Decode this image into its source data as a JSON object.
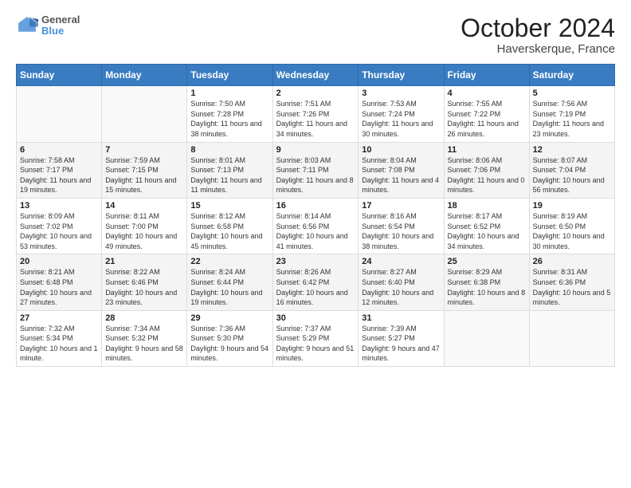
{
  "header": {
    "logo_line1": "General",
    "logo_line2": "Blue",
    "title": "October 2024",
    "subtitle": "Haverskerque, France"
  },
  "weekdays": [
    "Sunday",
    "Monday",
    "Tuesday",
    "Wednesday",
    "Thursday",
    "Friday",
    "Saturday"
  ],
  "weeks": [
    [
      {
        "day": "",
        "info": ""
      },
      {
        "day": "",
        "info": ""
      },
      {
        "day": "1",
        "info": "Sunrise: 7:50 AM\nSunset: 7:28 PM\nDaylight: 11 hours and 38 minutes."
      },
      {
        "day": "2",
        "info": "Sunrise: 7:51 AM\nSunset: 7:26 PM\nDaylight: 11 hours and 34 minutes."
      },
      {
        "day": "3",
        "info": "Sunrise: 7:53 AM\nSunset: 7:24 PM\nDaylight: 11 hours and 30 minutes."
      },
      {
        "day": "4",
        "info": "Sunrise: 7:55 AM\nSunset: 7:22 PM\nDaylight: 11 hours and 26 minutes."
      },
      {
        "day": "5",
        "info": "Sunrise: 7:56 AM\nSunset: 7:19 PM\nDaylight: 11 hours and 23 minutes."
      }
    ],
    [
      {
        "day": "6",
        "info": "Sunrise: 7:58 AM\nSunset: 7:17 PM\nDaylight: 11 hours and 19 minutes."
      },
      {
        "day": "7",
        "info": "Sunrise: 7:59 AM\nSunset: 7:15 PM\nDaylight: 11 hours and 15 minutes."
      },
      {
        "day": "8",
        "info": "Sunrise: 8:01 AM\nSunset: 7:13 PM\nDaylight: 11 hours and 11 minutes."
      },
      {
        "day": "9",
        "info": "Sunrise: 8:03 AM\nSunset: 7:11 PM\nDaylight: 11 hours and 8 minutes."
      },
      {
        "day": "10",
        "info": "Sunrise: 8:04 AM\nSunset: 7:08 PM\nDaylight: 11 hours and 4 minutes."
      },
      {
        "day": "11",
        "info": "Sunrise: 8:06 AM\nSunset: 7:06 PM\nDaylight: 11 hours and 0 minutes."
      },
      {
        "day": "12",
        "info": "Sunrise: 8:07 AM\nSunset: 7:04 PM\nDaylight: 10 hours and 56 minutes."
      }
    ],
    [
      {
        "day": "13",
        "info": "Sunrise: 8:09 AM\nSunset: 7:02 PM\nDaylight: 10 hours and 53 minutes."
      },
      {
        "day": "14",
        "info": "Sunrise: 8:11 AM\nSunset: 7:00 PM\nDaylight: 10 hours and 49 minutes."
      },
      {
        "day": "15",
        "info": "Sunrise: 8:12 AM\nSunset: 6:58 PM\nDaylight: 10 hours and 45 minutes."
      },
      {
        "day": "16",
        "info": "Sunrise: 8:14 AM\nSunset: 6:56 PM\nDaylight: 10 hours and 41 minutes."
      },
      {
        "day": "17",
        "info": "Sunrise: 8:16 AM\nSunset: 6:54 PM\nDaylight: 10 hours and 38 minutes."
      },
      {
        "day": "18",
        "info": "Sunrise: 8:17 AM\nSunset: 6:52 PM\nDaylight: 10 hours and 34 minutes."
      },
      {
        "day": "19",
        "info": "Sunrise: 8:19 AM\nSunset: 6:50 PM\nDaylight: 10 hours and 30 minutes."
      }
    ],
    [
      {
        "day": "20",
        "info": "Sunrise: 8:21 AM\nSunset: 6:48 PM\nDaylight: 10 hours and 27 minutes."
      },
      {
        "day": "21",
        "info": "Sunrise: 8:22 AM\nSunset: 6:46 PM\nDaylight: 10 hours and 23 minutes."
      },
      {
        "day": "22",
        "info": "Sunrise: 8:24 AM\nSunset: 6:44 PM\nDaylight: 10 hours and 19 minutes."
      },
      {
        "day": "23",
        "info": "Sunrise: 8:26 AM\nSunset: 6:42 PM\nDaylight: 10 hours and 16 minutes."
      },
      {
        "day": "24",
        "info": "Sunrise: 8:27 AM\nSunset: 6:40 PM\nDaylight: 10 hours and 12 minutes."
      },
      {
        "day": "25",
        "info": "Sunrise: 8:29 AM\nSunset: 6:38 PM\nDaylight: 10 hours and 8 minutes."
      },
      {
        "day": "26",
        "info": "Sunrise: 8:31 AM\nSunset: 6:36 PM\nDaylight: 10 hours and 5 minutes."
      }
    ],
    [
      {
        "day": "27",
        "info": "Sunrise: 7:32 AM\nSunset: 5:34 PM\nDaylight: 10 hours and 1 minute."
      },
      {
        "day": "28",
        "info": "Sunrise: 7:34 AM\nSunset: 5:32 PM\nDaylight: 9 hours and 58 minutes."
      },
      {
        "day": "29",
        "info": "Sunrise: 7:36 AM\nSunset: 5:30 PM\nDaylight: 9 hours and 54 minutes."
      },
      {
        "day": "30",
        "info": "Sunrise: 7:37 AM\nSunset: 5:29 PM\nDaylight: 9 hours and 51 minutes."
      },
      {
        "day": "31",
        "info": "Sunrise: 7:39 AM\nSunset: 5:27 PM\nDaylight: 9 hours and 47 minutes."
      },
      {
        "day": "",
        "info": ""
      },
      {
        "day": "",
        "info": ""
      }
    ]
  ]
}
